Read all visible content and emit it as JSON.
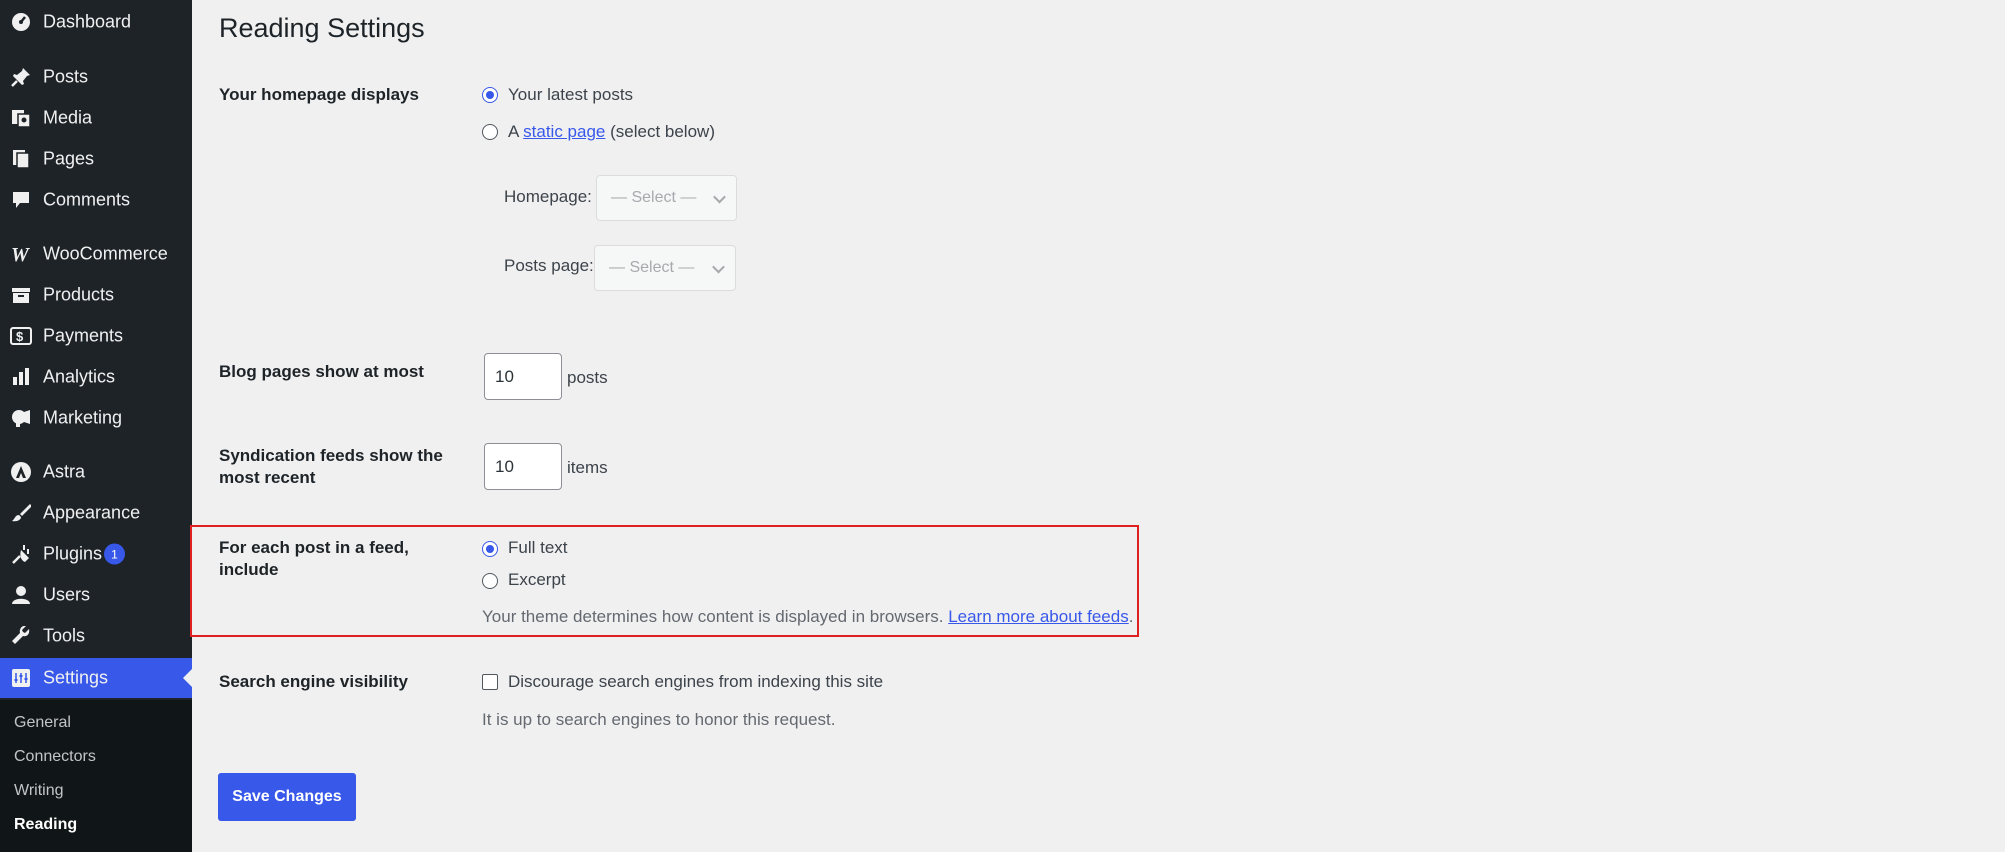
{
  "sidebar": {
    "items": [
      {
        "label": "Dashboard",
        "icon": "dashboard-icon"
      },
      {
        "label": "Posts",
        "icon": "pin-icon"
      },
      {
        "label": "Media",
        "icon": "media-icon"
      },
      {
        "label": "Pages",
        "icon": "pages-icon"
      },
      {
        "label": "Comments",
        "icon": "comment-icon"
      },
      {
        "label": "WooCommerce",
        "icon": "woocommerce-icon"
      },
      {
        "label": "Products",
        "icon": "archive-icon"
      },
      {
        "label": "Payments",
        "icon": "dollar-icon"
      },
      {
        "label": "Analytics",
        "icon": "bar-chart-icon"
      },
      {
        "label": "Marketing",
        "icon": "megaphone-icon"
      },
      {
        "label": "Astra",
        "icon": "astra-icon"
      },
      {
        "label": "Appearance",
        "icon": "paintbrush-icon"
      },
      {
        "label": "Plugins",
        "icon": "plug-icon",
        "badge": "1"
      },
      {
        "label": "Users",
        "icon": "user-icon"
      },
      {
        "label": "Tools",
        "icon": "wrench-icon"
      },
      {
        "label": "Settings",
        "icon": "settings-icon",
        "active": true
      }
    ],
    "submenu": [
      {
        "label": "General"
      },
      {
        "label": "Connectors"
      },
      {
        "label": "Writing"
      },
      {
        "label": "Reading",
        "current": true
      }
    ]
  },
  "main": {
    "title": "Reading Settings",
    "homepage": {
      "label": "Your homepage displays",
      "option_latest": "Your latest posts",
      "option_static_prefix": "A",
      "option_static_link": "static page",
      "option_static_suffix": "(select below)",
      "homepage_label": "Homepage:",
      "posts_page_label": "Posts page:",
      "select_placeholder": "— Select —",
      "selected": "latest"
    },
    "blog_pages": {
      "label": "Blog pages show at most",
      "value": "10",
      "unit": "posts"
    },
    "syndication": {
      "label_line1": "Syndication feeds show the",
      "label_line2": "most recent",
      "value": "10",
      "unit": "items"
    },
    "feed_include": {
      "label": "For each post in a feed, include",
      "option_full": "Full text",
      "option_excerpt": "Excerpt",
      "selected": "full",
      "description": "Your theme determines how content is displayed in browsers.",
      "link": "Learn more about feeds",
      "link_suffix": "."
    },
    "search_visibility": {
      "label": "Search engine visibility",
      "checkbox_label": "Discourage search engines from indexing this site",
      "checked": false,
      "description": "It is up to search engines to honor this request."
    },
    "save_button": "Save Changes"
  },
  "colors": {
    "accent": "#3858e9",
    "sidebar_bg": "#1d2327",
    "highlight": "#e02020"
  }
}
